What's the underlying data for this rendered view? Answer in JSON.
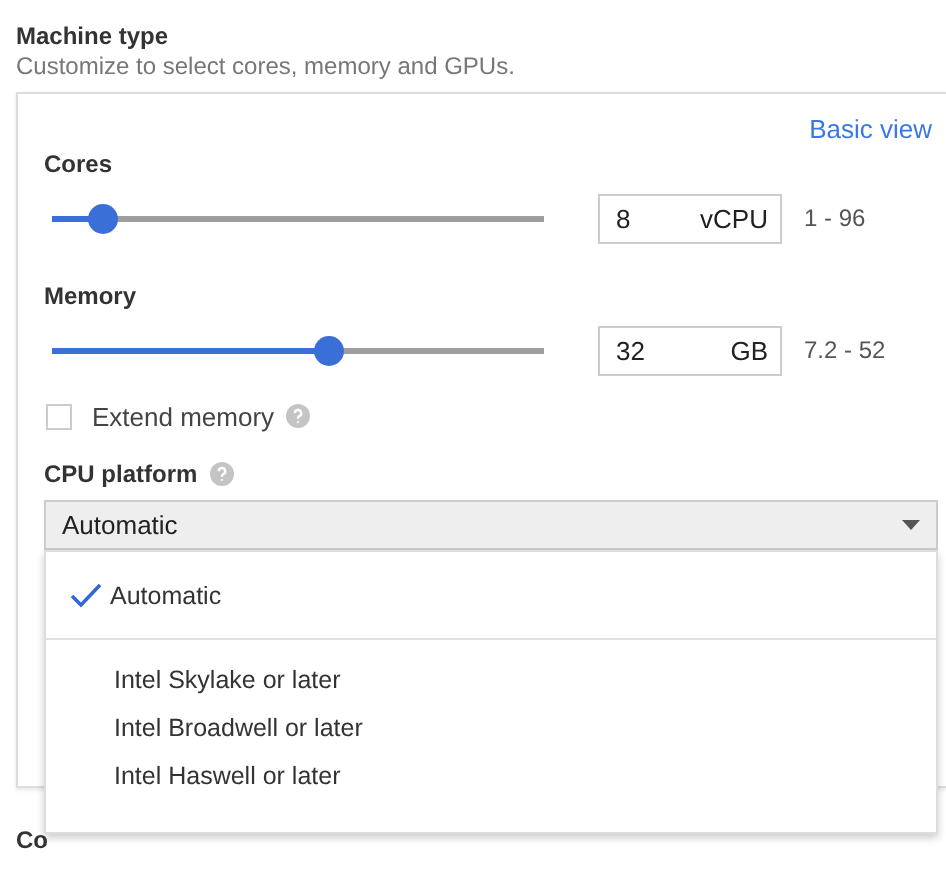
{
  "section": {
    "title": "Machine type",
    "subtitle": "Customize to select cores, memory and GPUs."
  },
  "basic_view_link": "Basic view",
  "sliders": [
    {
      "label": "Cores",
      "level": 0.1,
      "value": "8",
      "unit": "vCPU",
      "range": "1 - 96"
    },
    {
      "label": "Memory",
      "level": 0.56,
      "value": "32",
      "unit": "GB",
      "range": "7.2 - 52"
    }
  ],
  "extend_memory": {
    "label": "Extend memory",
    "checked": false
  },
  "cpu_platform": {
    "label": "CPU platform",
    "value": "Automatic",
    "expanded": true,
    "options": [
      {
        "label": "Automatic",
        "selected": true
      },
      {
        "label": "Intel Skylake or later",
        "selected": false
      },
      {
        "label": "Intel Broadwell or later",
        "selected": false
      },
      {
        "label": "Intel Haswell or later",
        "selected": false
      }
    ]
  },
  "next_section_label": "Co"
}
